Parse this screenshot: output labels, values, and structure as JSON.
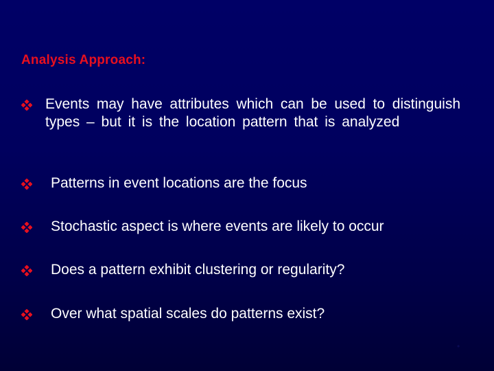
{
  "slide": {
    "heading": "Analysis Approach:",
    "accent_color": "#e8101e",
    "text_color": "#ffffff",
    "background_color_top": "#000066",
    "background_color_bottom": "#000036",
    "bullet_icon": "diamond-of-four-dots-icon",
    "bullets": [
      {
        "text": "Events may have attributes which can be used to distinguish types – but it is the location pattern that is analyzed"
      },
      {
        "text": "Patterns in event locations are the focus"
      },
      {
        "text": "Stochastic aspect is where events are likely to occur"
      },
      {
        "text": "Does a pattern exhibit clustering or regularity?"
      },
      {
        "text": "Over what spatial scales do patterns exist?"
      }
    ]
  }
}
